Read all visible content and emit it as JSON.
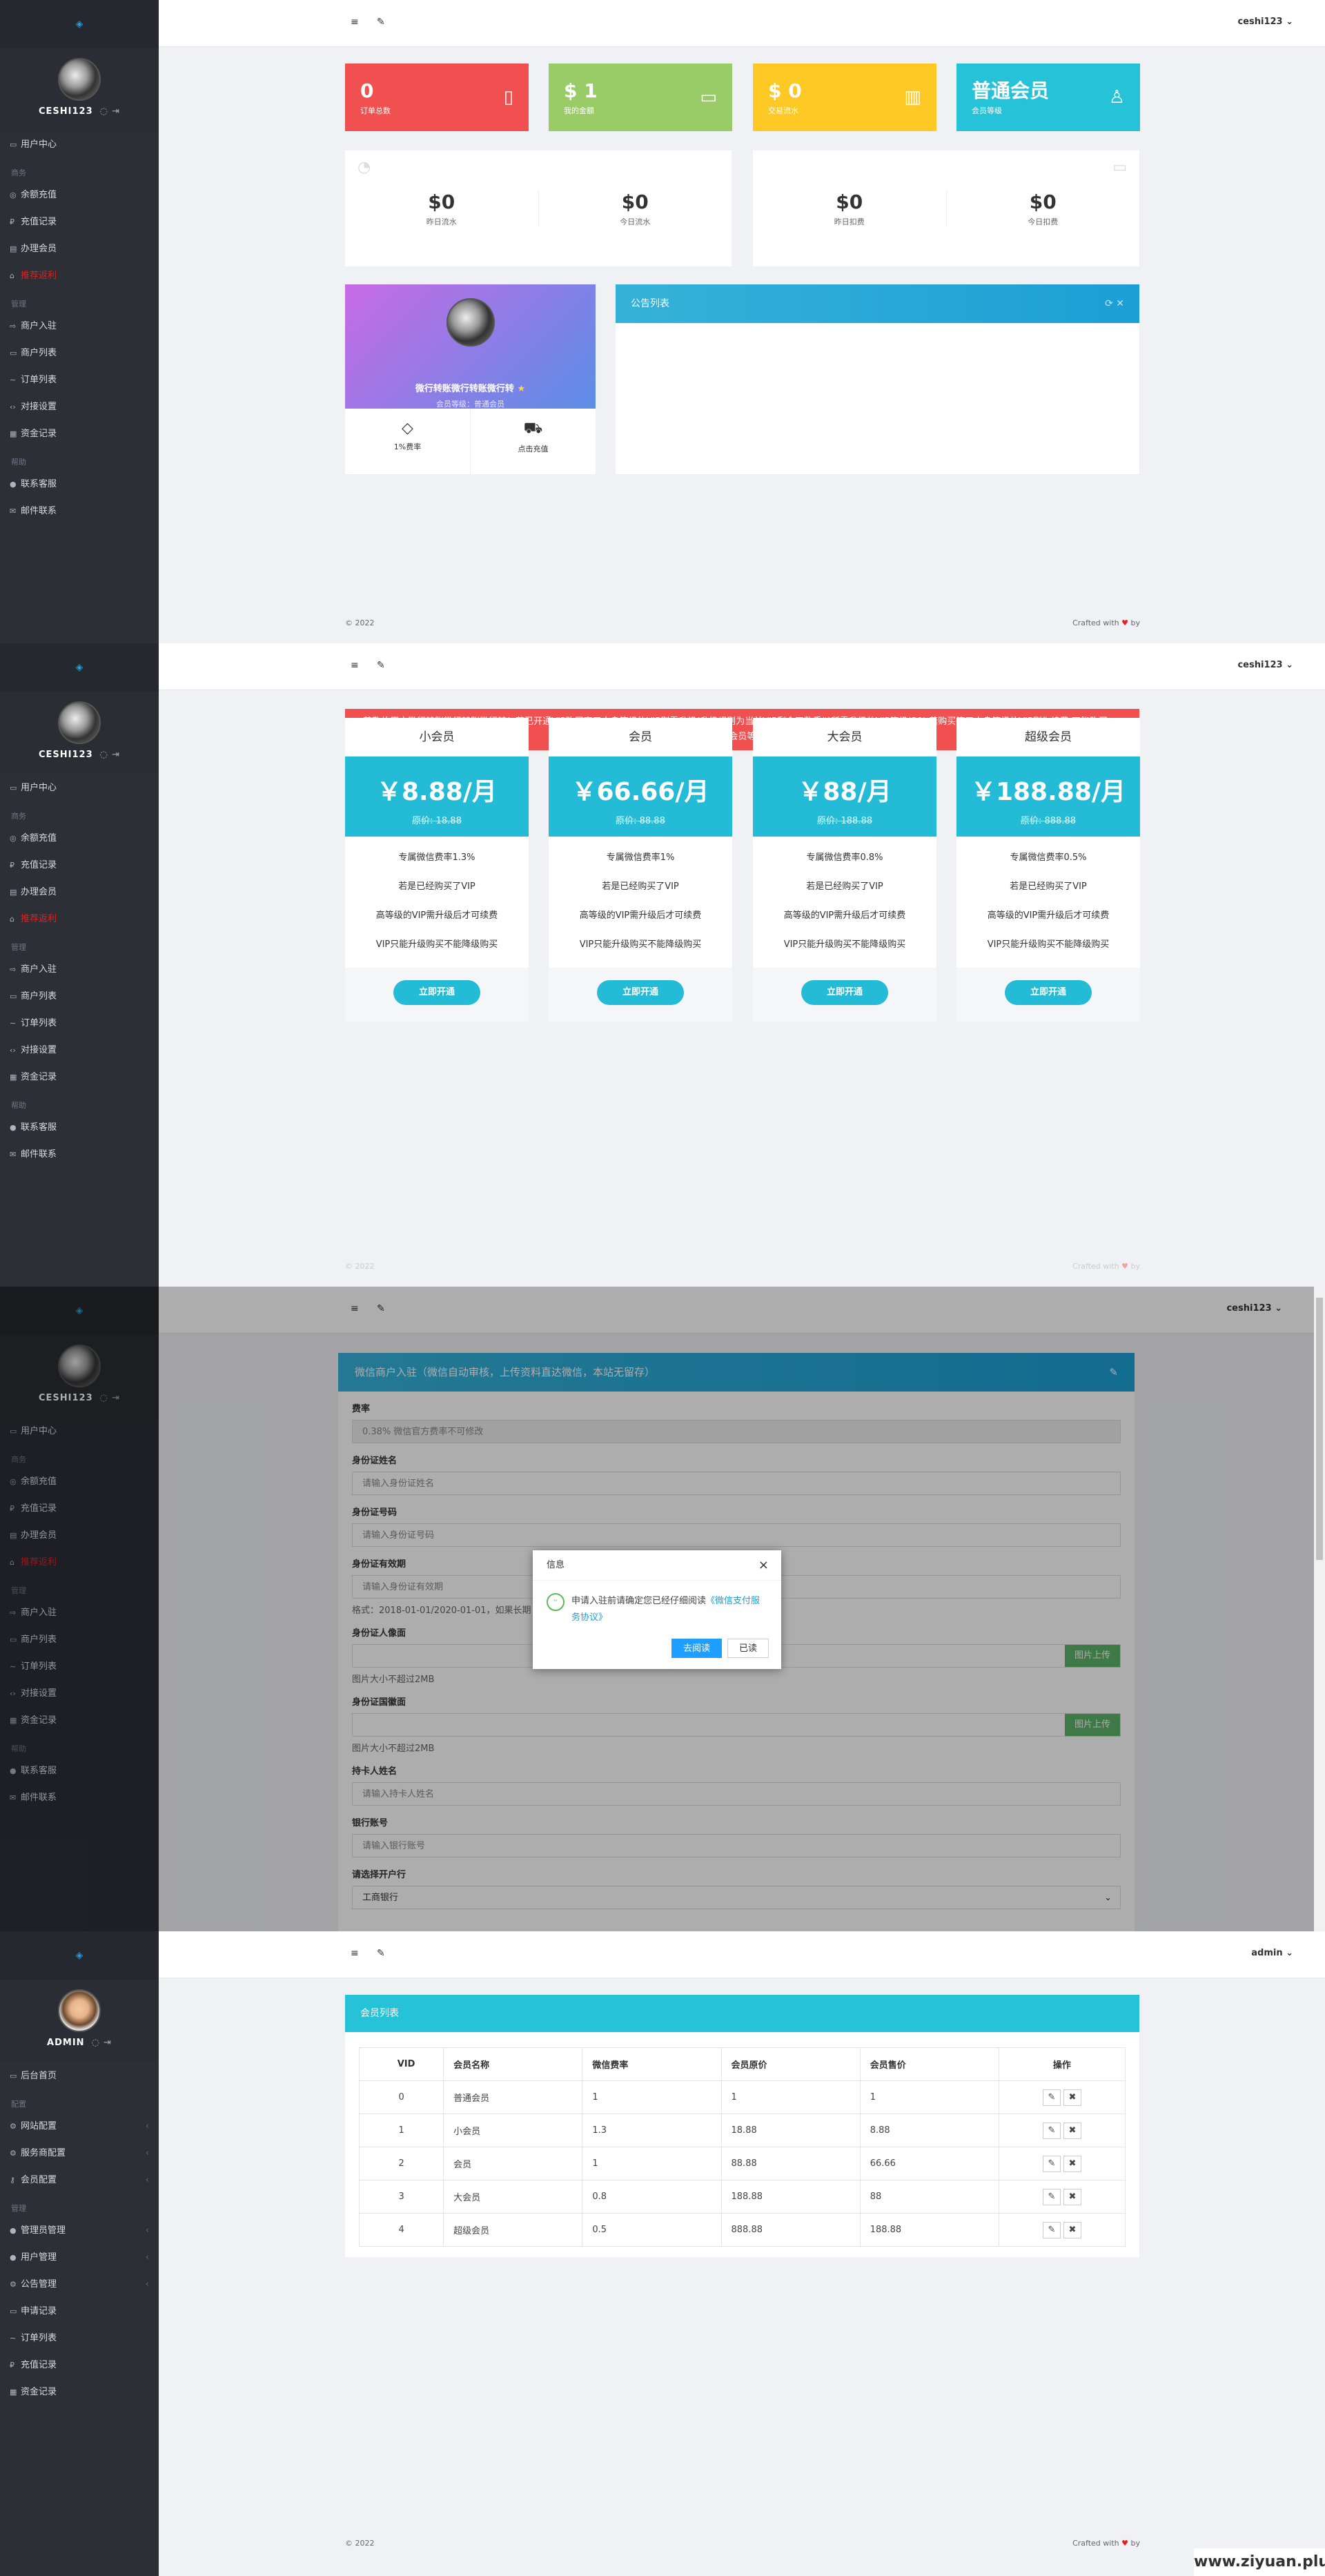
{
  "sidebar_user": {
    "user_name": "CESHI123",
    "admin_name": "ADMIN",
    "logo_glyph": "◈"
  },
  "user_menu": {
    "items_top": [
      {
        "label": "用户中心",
        "icon": "home-icon"
      }
    ],
    "head1": "商务",
    "items_a": [
      {
        "label": "余额充值",
        "icon": "coin-icon"
      },
      {
        "label": "充值记录",
        "icon": "p-icon"
      },
      {
        "label": "办理会员",
        "icon": "card-icon"
      },
      {
        "label": "推荐返利",
        "icon": "gift-icon",
        "red": true
      }
    ],
    "head2": "管理",
    "items_b": [
      {
        "label": "商户入驻",
        "icon": "login-icon"
      },
      {
        "label": "商户列表",
        "icon": "list-icon"
      },
      {
        "label": "订单列表",
        "icon": "trend-icon"
      },
      {
        "label": "对接设置",
        "icon": "code-icon"
      },
      {
        "label": "资金记录",
        "icon": "book-icon"
      }
    ],
    "head3": "帮助",
    "items_c": [
      {
        "label": "联系客服",
        "icon": "bell-icon"
      },
      {
        "label": "邮件联系",
        "icon": "mail-icon"
      }
    ]
  },
  "admin_menu": {
    "items_top": [
      {
        "label": "后台首页"
      }
    ],
    "head1": "配置",
    "items_a": [
      {
        "label": "网站配置"
      },
      {
        "label": "服务商配置"
      },
      {
        "label": "会员配置"
      }
    ],
    "head2": "管理",
    "items_b": [
      {
        "label": "管理员管理"
      },
      {
        "label": "用户管理"
      },
      {
        "label": "公告管理"
      },
      {
        "label": "申请记录"
      },
      {
        "label": "订单列表"
      },
      {
        "label": "充值记录"
      },
      {
        "label": "资金记录"
      }
    ]
  },
  "topbar": {
    "user": "ceshi123",
    "admin": "admin",
    "menu_glyph": "≡",
    "wrench_glyph": "✎"
  },
  "dashboard": {
    "stats": [
      {
        "value": "0",
        "label": "订单总数",
        "color": "#f0504f",
        "icon": "clipboard-icon",
        "glyph": "▯"
      },
      {
        "value": "$ 1",
        "label": "我的金额",
        "color": "#99cc66",
        "icon": "wallet-icon",
        "glyph": "▭"
      },
      {
        "value": "$ 0",
        "label": "交易流水",
        "color": "#ffc925",
        "icon": "bar-chart-icon",
        "glyph": "▥"
      },
      {
        "value": "普通会员",
        "label": "会员等级",
        "color": "#26c2d8",
        "icon": "user-icon",
        "glyph": "♙"
      }
    ],
    "flow": [
      {
        "value": "$0",
        "label": "昨日流水"
      },
      {
        "value": "$0",
        "label": "今日流水"
      }
    ],
    "fees": [
      {
        "value": "$0",
        "label": "昨日扣费"
      },
      {
        "value": "$0",
        "label": "今日扣费"
      }
    ],
    "profile": {
      "name": "微行转账微行转账微行转",
      "level": "会员等级：普通会员",
      "rate": "1%费率",
      "recharge": "点击充值"
    },
    "notice_title": "公告列表"
  },
  "footer": {
    "copyright": "© 2022",
    "crafted": "Crafted with",
    "by": "by"
  },
  "vip": {
    "alert": "尊敬的用户微行转账微行转账微行转！若已开通VIP购买高于本身等级的VIP则需升级(升级规则为当前VIP剩余天数乘以所需升级的VIP等级(30),若购买等于本身等级的VIP则为续费,不能购买低于本身会员等级的!",
    "plans": [
      {
        "name": "小会员",
        "price": "￥8.88/月",
        "orig": "原价: 18.88",
        "f1": "专属微信费率1.3%",
        "f2": "若是已经购买了VIP",
        "f3": "高等级的VIP需升级后才可续费",
        "f4": "VIP只能升级购买不能降级购买",
        "btn": "立即开通"
      },
      {
        "name": "会员",
        "price": "￥66.66/月",
        "orig": "原价: 88.88",
        "f1": "专属微信费率1%",
        "f2": "若是已经购买了VIP",
        "f3": "高等级的VIP需升级后才可续费",
        "f4": "VIP只能升级购买不能降级购买",
        "btn": "立即开通"
      },
      {
        "name": "大会员",
        "price": "￥88/月",
        "orig": "原价: 188.88",
        "f1": "专属微信费率0.8%",
        "f2": "若是已经购买了VIP",
        "f3": "高等级的VIP需升级后才可续费",
        "f4": "VIP只能升级购买不能降级购买",
        "btn": "立即开通"
      },
      {
        "name": "超级会员",
        "price": "￥188.88/月",
        "orig": "原价: 888.88",
        "f1": "专属微信费率0.5%",
        "f2": "若是已经购买了VIP",
        "f3": "高等级的VIP需升级后才可续费",
        "f4": "VIP只能升级购买不能降级购买",
        "btn": "立即开通"
      }
    ]
  },
  "form": {
    "title": "微信商户入驻（微信自动审核，上传资料直达微信，本站无留存）",
    "rate_label": "费率",
    "rate_value": "0.38%    微信官方费率不可修改",
    "name_label": "身份证姓名",
    "name_ph": "请输入身份证姓名",
    "id_label": "身份证号码",
    "id_ph": "请输入身份证号码",
    "exp_label": "身份证有效期",
    "exp_ph": "请输入身份证有效期",
    "exp_hint": "格式：2018-01-01/2020-01-01，如果长期",
    "front_label": "身份证人像面",
    "upload": "图片上传",
    "size_hint": "图片大小不超过2MB",
    "back_label": "身份证国徽面",
    "holder_label": "持卡人姓名",
    "holder_ph": "请输入持卡人姓名",
    "bank_no_label": "银行账号",
    "bank_no_ph": "请输入银行账号",
    "bank_label": "请选择开户行",
    "bank_value": "工商银行"
  },
  "dialog": {
    "title": "信息",
    "text_pre": "申请入驻前请确定您已经仔细阅读",
    "link": "《微信支付服务协议》",
    "btn_read": "去阅读",
    "btn_done": "已读"
  },
  "member_table": {
    "title": "会员列表",
    "headers": [
      "VID",
      "会员名称",
      "微信费率",
      "会员原价",
      "会员售价",
      "操作"
    ],
    "rows": [
      [
        "0",
        "普通会员",
        "1",
        "1",
        "1"
      ],
      [
        "1",
        "小会员",
        "1.3",
        "18.88",
        "8.88"
      ],
      [
        "2",
        "会员",
        "1",
        "88.88",
        "66.66"
      ],
      [
        "3",
        "大会员",
        "0.8",
        "188.88",
        "88"
      ],
      [
        "4",
        "超级会员",
        "0.5",
        "888.88",
        "188.88"
      ]
    ]
  },
  "watermark": "www.ziyuan.plus"
}
